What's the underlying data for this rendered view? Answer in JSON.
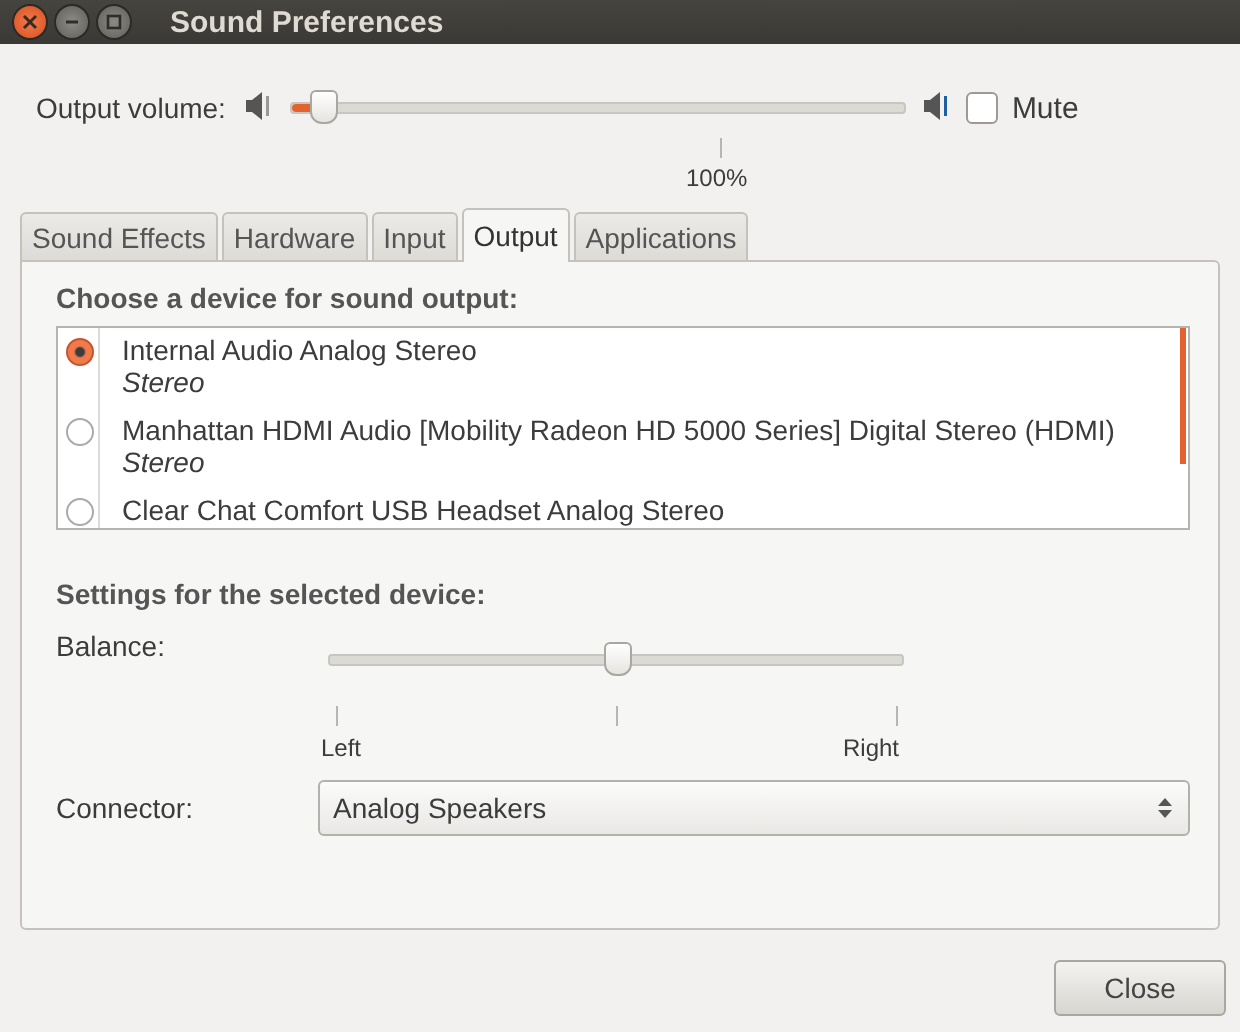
{
  "window": {
    "title": "Sound Preferences"
  },
  "volume": {
    "label": "Output volume:",
    "level": 0.05,
    "reading": "100%",
    "mute": {
      "label": "Mute",
      "checked": false
    }
  },
  "tabs": [
    {
      "label": "Sound Effects",
      "selected": false
    },
    {
      "label": "Hardware",
      "selected": false
    },
    {
      "label": "Input",
      "selected": false
    },
    {
      "label": "Output",
      "selected": true
    },
    {
      "label": "Applications",
      "selected": false
    }
  ],
  "device_heading": "Choose a device for sound output:",
  "devices": [
    {
      "name": "Internal Audio Analog Stereo",
      "profile": "Stereo",
      "selected": true
    },
    {
      "name": "Manhattan HDMI Audio [Mobility Radeon HD 5000 Series] Digital Stereo (HDMI)",
      "profile": "Stereo",
      "selected": false
    },
    {
      "name": "Clear Chat Comfort USB Headset Analog Stereo",
      "selected": false
    }
  ],
  "settings_heading": "Settings for the selected device:",
  "balance": {
    "label": "Balance:",
    "level": 0.5,
    "left": "Left",
    "right": "Right"
  },
  "connector": {
    "label": "Connector:",
    "value": "Analog Speakers"
  },
  "buttons": [
    {
      "label": "Close"
    }
  ]
}
